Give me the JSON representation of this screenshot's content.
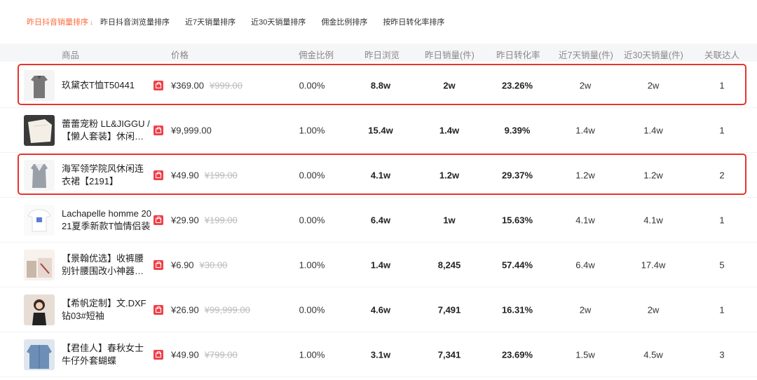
{
  "sort_tabs": [
    {
      "label": "昨日抖音销量排序",
      "active": true,
      "arrow": "↓"
    },
    {
      "label": "昨日抖音浏览量排序"
    },
    {
      "label": "近7天销量排序"
    },
    {
      "label": "近30天销量排序"
    },
    {
      "label": "佣金比例排序"
    },
    {
      "label": "按昨日转化率排序"
    }
  ],
  "columns": [
    "商品",
    "价格",
    "佣金比例",
    "昨日浏览",
    "昨日销量(件)",
    "昨日转化率",
    "近7天销量(件)",
    "近30天销量(件)",
    "关联达人"
  ],
  "rows": [
    {
      "name": "玖黛衣T恤T50441",
      "price": "¥369.00",
      "orig": "¥999.00",
      "commission": "0.00%",
      "views": "8.8w",
      "sales": "2w",
      "conversion": "23.26%",
      "sales7": "2w",
      "sales30": "2w",
      "influencers": "1",
      "thumb": "gray-dress",
      "highlight": true
    },
    {
      "name": "蕾蕾宠粉 LL&JIGGU /【懒人套装】休闲两件套",
      "price": "¥9,999.00",
      "orig": "",
      "commission": "1.00%",
      "views": "15.4w",
      "sales": "1.4w",
      "conversion": "9.39%",
      "sales7": "1.4w",
      "sales30": "1.4w",
      "influencers": "1",
      "thumb": "white-set"
    },
    {
      "name": "海军领学院风休闲连衣裙【2191】",
      "price": "¥49.90",
      "orig": "¥199.00",
      "commission": "0.00%",
      "views": "4.1w",
      "sales": "1.2w",
      "conversion": "29.37%",
      "sales7": "1.2w",
      "sales30": "1.2w",
      "influencers": "2",
      "thumb": "navy-dress",
      "highlight": true
    },
    {
      "name": "Lachapelle homme 2021夏季新款T恤情侣装",
      "price": "¥29.90",
      "orig": "¥199.00",
      "commission": "0.00%",
      "views": "6.4w",
      "sales": "1w",
      "conversion": "15.63%",
      "sales7": "4.1w",
      "sales30": "4.1w",
      "influencers": "1",
      "thumb": "white-tee"
    },
    {
      "name": "【景翰优选】收裤腰别针腰围改小神器固定扣",
      "price": "¥6.90",
      "orig": "¥30.00",
      "commission": "1.00%",
      "views": "1.4w",
      "sales": "8,245",
      "conversion": "57.44%",
      "sales7": "6.4w",
      "sales30": "17.4w",
      "influencers": "5",
      "thumb": "pins"
    },
    {
      "name": "【希帆定制】文.DXF钻03#短袖",
      "price": "¥26.90",
      "orig": "¥99,999.00",
      "commission": "0.00%",
      "views": "4.6w",
      "sales": "7,491",
      "conversion": "16.31%",
      "sales7": "2w",
      "sales30": "2w",
      "influencers": "1",
      "thumb": "girl"
    },
    {
      "name": "【君佳人】春秋女士牛仔外套蝴蝶",
      "price": "¥49.90",
      "orig": "¥799.00",
      "commission": "1.00%",
      "views": "3.1w",
      "sales": "7,341",
      "conversion": "23.69%",
      "sales7": "1.5w",
      "sales30": "4.5w",
      "influencers": "3",
      "thumb": "denim"
    }
  ]
}
